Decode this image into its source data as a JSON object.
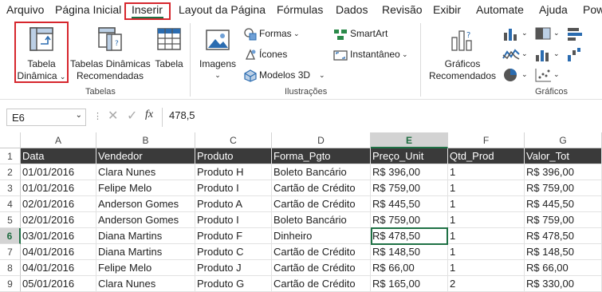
{
  "menu": {
    "tabs": [
      "Arquivo",
      "Página Inicial",
      "Inserir",
      "Layout da Página",
      "Fórmulas",
      "Dados",
      "Revisão",
      "Exibir",
      "Automate",
      "Ajuda",
      "Pow"
    ],
    "active": "Inserir"
  },
  "ribbon": {
    "tabela_dinamica": "Tabela\nDinâmica",
    "tabela_dinamica_l1": "Tabela",
    "tabela_dinamica_l2": "Dinâmica",
    "tabelas_dinamicas_l1": "Tabelas Dinâmicas",
    "tabelas_dinamicas_l2": "Recomendadas",
    "tabela": "Tabela",
    "grupo_tabelas": "Tabelas",
    "imagens": "Imagens",
    "formas": "Formas",
    "icones": "Ícones",
    "modelos3d": "Modelos 3D",
    "smartart": "SmartArt",
    "instantaneo": "Instantâneo",
    "grupo_ilustracoes": "Ilustrações",
    "graficos_l1": "Gráficos",
    "graficos_l2": "Recomendados",
    "grupo_graficos": "Gráficos"
  },
  "formula_bar": {
    "name_box": "E6",
    "fx": "fx",
    "value": "478,5"
  },
  "sheet": {
    "columns": [
      "A",
      "B",
      "C",
      "D",
      "E",
      "F",
      "G"
    ],
    "selected_column": "E",
    "selected_row": "6",
    "header": [
      "Data",
      "Vendedor",
      "Produto",
      "Forma_Pgto",
      "Preço_Unit",
      "Qtd_Prod",
      "Valor_Tot"
    ],
    "rows": [
      {
        "n": "2",
        "cells": [
          "01/01/2016",
          "Clara Nunes",
          "Produto H",
          "Boleto Bancário",
          "R$ 396,00",
          "1",
          "R$ 396,00"
        ]
      },
      {
        "n": "3",
        "cells": [
          "01/01/2016",
          "Felipe Melo",
          "Produto I",
          "Cartão de Crédito",
          "R$ 759,00",
          "1",
          "R$ 759,00"
        ]
      },
      {
        "n": "4",
        "cells": [
          "02/01/2016",
          "Anderson Gomes",
          "Produto A",
          "Cartão de Crédito",
          "R$ 445,50",
          "1",
          "R$ 445,50"
        ]
      },
      {
        "n": "5",
        "cells": [
          "02/01/2016",
          "Anderson Gomes",
          "Produto I",
          "Boleto Bancário",
          "R$ 759,00",
          "1",
          "R$ 759,00"
        ]
      },
      {
        "n": "6",
        "cells": [
          "03/01/2016",
          "Diana Martins",
          "Produto F",
          "Dinheiro",
          "R$ 478,50",
          "1",
          "R$ 478,50"
        ]
      },
      {
        "n": "7",
        "cells": [
          "04/01/2016",
          "Diana Martins",
          "Produto C",
          "Cartão de Crédito",
          "R$ 148,50",
          "1",
          "R$ 148,50"
        ]
      },
      {
        "n": "8",
        "cells": [
          "04/01/2016",
          "Felipe Melo",
          "Produto J",
          "Cartão de Crédito",
          "R$ 66,00",
          "1",
          "R$ 66,00"
        ]
      },
      {
        "n": "9",
        "cells": [
          "05/01/2016",
          "Clara Nunes",
          "Produto G",
          "Cartão de Crédito",
          "R$ 165,00",
          "2",
          "R$ 330,00"
        ]
      }
    ]
  },
  "colors": {
    "accent": "#1f7145",
    "highlight": "#d6262d",
    "header_bg": "#3a3a3a"
  }
}
